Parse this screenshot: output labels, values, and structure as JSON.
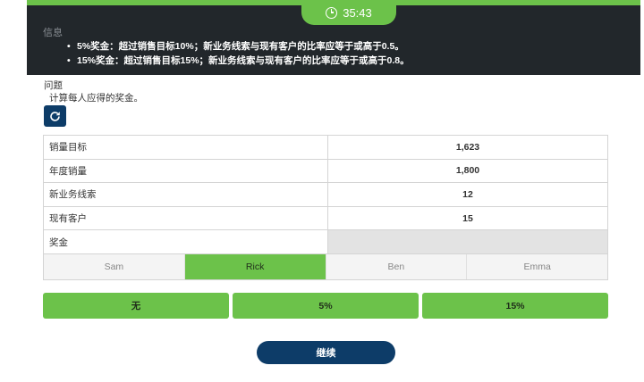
{
  "timer": {
    "value": "35:43",
    "icon": "clock-icon"
  },
  "info": {
    "title": "信息",
    "bullets": [
      "5%奖金：超过销售目标10%；新业务线索与现有客户的比率应等于或高于0.5。",
      "15%奖金：超过销售目标15%；新业务线索与现有客户的比率应等于或高于0.8。"
    ]
  },
  "question": {
    "label": "问题",
    "text": "计算每人应得的奖金。",
    "refresh_icon": "refresh-icon"
  },
  "table": {
    "rows": [
      {
        "label": "销量目标",
        "value": "1,623"
      },
      {
        "label": "年度销量",
        "value": "1,800"
      },
      {
        "label": "新业务线索",
        "value": "12"
      },
      {
        "label": "现有客户",
        "value": "15"
      },
      {
        "label": "奖金",
        "value": ""
      }
    ]
  },
  "people_tabs": [
    "Sam",
    "Rick",
    "Ben",
    "Emma"
  ],
  "active_tab": "Rick",
  "options": [
    "无",
    "5%",
    "15%"
  ],
  "continue_label": "继续",
  "colors": {
    "accent_green": "#6cc24a",
    "navy": "#0d3c68",
    "dark_panel": "#22272b"
  }
}
